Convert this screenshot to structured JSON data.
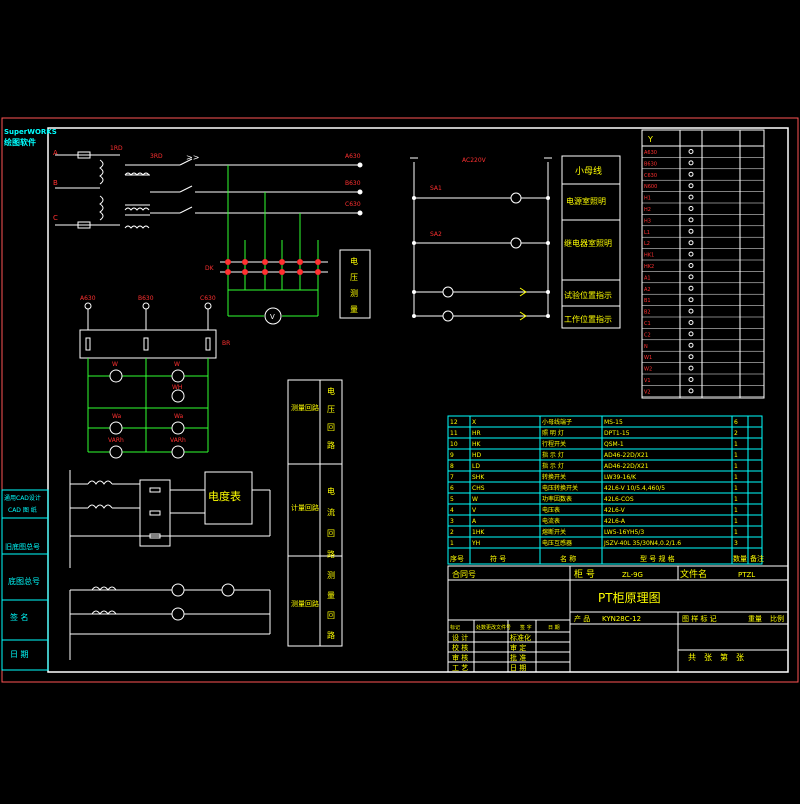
{
  "colors": {
    "frame": "#ff5555",
    "wire_green": "#30ff30",
    "white": "#ffffff",
    "cyan": "#00ffff",
    "red": "#ff3030",
    "yellow": "#ffff00",
    "magenta": "#ff00ff"
  },
  "left_sidebar": {
    "logo_line1": "SuperWORKS",
    "logo_line2": "绘图软件",
    "panel1": "通用CAD设计",
    "panel1_sub": "CAD 图 纸",
    "panel2": "旧底图总号",
    "panel3": "底图总号",
    "panel4": "签 名",
    "panel5": "日 期"
  },
  "primary": {
    "phase_a": "A",
    "phase_b": "B",
    "phase_c": "C",
    "fuse_label": "1RD",
    "pt_label": "3RD",
    "out_a": "A630",
    "out_b": "B630",
    "out_c": "C630",
    "v_label": "V",
    "voltage_meas": [
      "电",
      "压",
      "测",
      "量"
    ],
    "terminal_label": "DK"
  },
  "secondary": {
    "top_a": "A630",
    "top_b": "B630",
    "top_c": "C630",
    "res_label": "BR",
    "meter_labels": [
      "W",
      "W",
      "WH",
      "Wa",
      "Wa",
      "VARh",
      "VARh"
    ]
  },
  "control": {
    "power_label": "AC220V",
    "sa1": "SA1",
    "sa2": "SA2",
    "rows": [
      "小母线",
      "电源室照明",
      "继电器室照明",
      "试验位置指示",
      "工作位置指示"
    ]
  },
  "function_box": {
    "left": [
      "测量回路",
      "计量回路",
      "测量回路"
    ],
    "right_top": [
      "电",
      "压",
      "回",
      "路"
    ],
    "right_mid": [
      "电",
      "流",
      "回",
      "路"
    ],
    "right_bot": [
      "测",
      "量",
      "回",
      "路"
    ]
  },
  "energy_meter": "电度表",
  "bom": {
    "rows": [
      [
        "12",
        "X",
        "小母线端子",
        "MS-15",
        "",
        "6",
        ""
      ],
      [
        "11",
        "HR",
        "照 明 灯",
        "DPT1-15",
        "",
        "2",
        ""
      ],
      [
        "10",
        "HK",
        "行程开关",
        "QSM-1",
        "",
        "1",
        ""
      ],
      [
        "9",
        "HD",
        "指 示 灯",
        "AD46-22D/X21",
        "",
        "1",
        ""
      ],
      [
        "8",
        "LD",
        "指 示 灯",
        "AD46-22D/X21",
        "",
        "1",
        ""
      ],
      [
        "7",
        "SHK",
        "转换开关",
        "LW39-16/K",
        "",
        "1",
        ""
      ],
      [
        "6",
        "CHS",
        "电压转换开关",
        "42L6-V 10/5.4,460/5",
        "",
        "1",
        ""
      ],
      [
        "5",
        "W",
        "功率因数表",
        "42L6-COS",
        "",
        "1",
        ""
      ],
      [
        "4",
        "V",
        "电压表",
        "42L6-V",
        "",
        "1",
        ""
      ],
      [
        "3",
        "A",
        "电流表",
        "42L6-A",
        "",
        "1",
        ""
      ],
      [
        "2",
        "1HK",
        "熔断开关",
        "LW5-16YH5/3",
        "",
        "1",
        ""
      ],
      [
        "1",
        "YH",
        "电压互感器",
        "JSZV-40L 35/30N4,0.2/1.6",
        "",
        "3",
        ""
      ]
    ],
    "header": [
      "序号",
      "符 号",
      "名 称",
      "型 号 规 格",
      "数量",
      "备注"
    ]
  },
  "title_block": {
    "contract_label": "合同号",
    "cabinet_label": "柜 号",
    "cabinet_no": "ZL-9G",
    "file_label": "文件名",
    "file_name": "PTZL",
    "drawing_title": "PT柜原理图",
    "product_label": "产 品",
    "product_name": "KYN28C-12",
    "stage_label": "图 样 标 记",
    "weight_label": "重量",
    "scale_label": "比例",
    "sheets_label": "共　张　第　张",
    "sign_rows": [
      "设 计",
      "校 核",
      "审 核",
      "工 艺"
    ],
    "sign_right": [
      "标准化",
      "审 定",
      "批 准",
      "日 期"
    ],
    "change_header": [
      "标记",
      "处数",
      "更改文件号",
      "签 字",
      "日 期"
    ]
  },
  "right_table": {
    "header": "Y",
    "labels": [
      "A630",
      "B630",
      "C630",
      "N600",
      "H1",
      "H2",
      "H3",
      "L1",
      "L2",
      "HK1",
      "HK2",
      "A1",
      "A2",
      "B1",
      "B2",
      "C1",
      "C2",
      "N",
      "W1",
      "W2",
      "V1",
      "V2"
    ]
  }
}
